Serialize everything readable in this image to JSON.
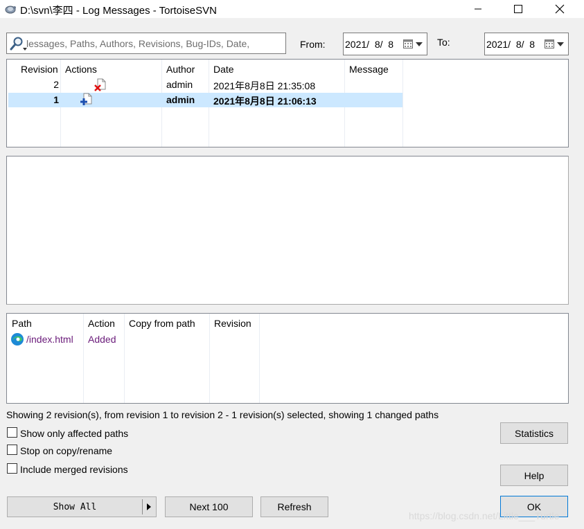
{
  "window": {
    "title": "D:\\svn\\李四 - Log Messages - TortoiseSVN"
  },
  "search": {
    "text": "lessages, Paths, Authors, Revisions, Bug-IDs, Date,"
  },
  "filter": {
    "from_label": "From:",
    "from_date": "2021/  8/  8",
    "to_label": "To:",
    "to_date": "2021/  8/  8"
  },
  "log_list": {
    "columns": [
      "Revision",
      "Actions",
      "Author",
      "Date",
      "Message"
    ],
    "rows": [
      {
        "revision": "2",
        "action_icon": "deleted-file-icon",
        "author": "admin",
        "date": "2021年8月8日 21:35:08",
        "message": "",
        "selected": false
      },
      {
        "revision": "1",
        "action_icon": "added-file-icon",
        "author": "admin",
        "date": "2021年8月8日 21:06:13",
        "message": "",
        "selected": true
      }
    ]
  },
  "paths_list": {
    "columns": [
      "Path",
      "Action",
      "Copy from path",
      "Revision"
    ],
    "rows": [
      {
        "icon": "edge-browser-icon",
        "path": "/index.html",
        "action": "Added",
        "copy_from": "",
        "revision": ""
      }
    ]
  },
  "status": {
    "text": "Showing 2 revision(s), from revision 1 to revision 2 - 1 revision(s) selected, showing 1 changed paths"
  },
  "options": {
    "show_only_affected": {
      "label": "Show only affected paths",
      "checked": false
    },
    "stop_on_copy": {
      "label": "Stop on copy/rename",
      "checked": false
    },
    "include_merged": {
      "label": "Include merged revisions",
      "checked": false
    }
  },
  "buttons": {
    "show_all": "Show All",
    "next_100": "Next 100",
    "refresh": "Refresh",
    "statistics": "Statistics",
    "help": "Help",
    "ok": "OK"
  },
  "watermark": "https://blog.csdn.net/Little___Turtle",
  "colors": {
    "selected_row": "#cce8ff",
    "added_action": "#6a1b7a",
    "path_text": "#6a1b7a",
    "deleted_mark": "#e01010",
    "added_mark": "#1c4fb0"
  }
}
